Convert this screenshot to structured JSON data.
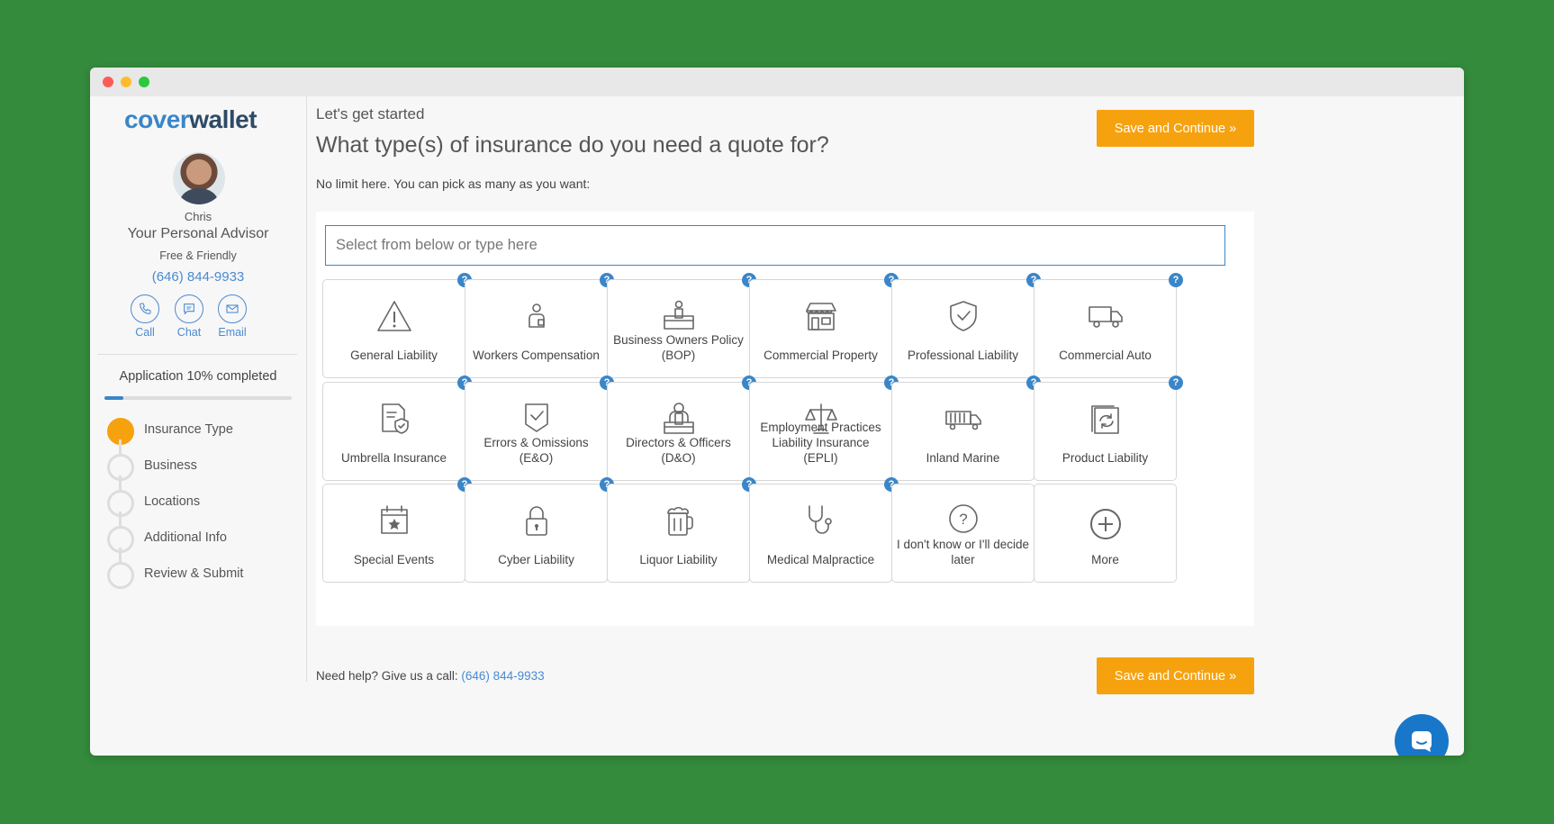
{
  "brand": {
    "logo_part1": "cover",
    "logo_part2": "wallet"
  },
  "advisor": {
    "name": "Chris",
    "role": "Your Personal Advisor",
    "tagline": "Free & Friendly",
    "phone": "(646) 844-9933",
    "actions": [
      {
        "label": "Call",
        "icon": "phone-icon"
      },
      {
        "label": "Chat",
        "icon": "chat-icon"
      },
      {
        "label": "Email",
        "icon": "email-icon"
      }
    ]
  },
  "progress": {
    "text": "Application 10% completed",
    "percent": 10
  },
  "steps": [
    {
      "label": "Insurance Type",
      "active": true
    },
    {
      "label": "Business",
      "active": false
    },
    {
      "label": "Locations",
      "active": false
    },
    {
      "label": "Additional Info",
      "active": false
    },
    {
      "label": "Review & Submit",
      "active": false
    }
  ],
  "main": {
    "eyebrow": "Let's get started",
    "heading": "What type(s) of insurance do you need a quote for?",
    "subheading": "No limit here. You can pick as many as you want:",
    "save_label": "Save and Continue »",
    "search_placeholder": "Select from below or type here",
    "help_symbol": "?",
    "footer_text": "Need help? Give us a call: ",
    "footer_phone": "(646) 844-9933"
  },
  "insurance_types": [
    {
      "label": "General Liability",
      "icon": "warning-icon",
      "help": true
    },
    {
      "label": "Workers Compensation",
      "icon": "worker-icon",
      "help": true
    },
    {
      "label": "Business Owners Policy (BOP)",
      "icon": "business-owner-icon",
      "help": true
    },
    {
      "label": "Commercial Property",
      "icon": "storefront-icon",
      "help": true
    },
    {
      "label": "Professional Liability",
      "icon": "shield-check-icon",
      "help": true
    },
    {
      "label": "Commercial Auto",
      "icon": "truck-icon",
      "help": true
    },
    {
      "label": "Umbrella Insurance",
      "icon": "document-shield-icon",
      "help": true
    },
    {
      "label": "Errors & Omissions (E&O)",
      "icon": "badge-check-icon",
      "help": true
    },
    {
      "label": "Directors & Officers (D&O)",
      "icon": "director-icon",
      "help": true
    },
    {
      "label": "Employment Practices Liability Insurance (EPLI)",
      "icon": "scales-icon",
      "help": true
    },
    {
      "label": "Inland Marine",
      "icon": "cargo-truck-icon",
      "help": true
    },
    {
      "label": "Product Liability",
      "icon": "product-box-icon",
      "help": true
    },
    {
      "label": "Special Events",
      "icon": "calendar-star-icon",
      "help": true
    },
    {
      "label": "Cyber Liability",
      "icon": "lock-icon",
      "help": true
    },
    {
      "label": "Liquor Liability",
      "icon": "beer-mug-icon",
      "help": true
    },
    {
      "label": "Medical Malpractice",
      "icon": "stethoscope-icon",
      "help": true
    },
    {
      "label": "I don't know or I'll decide later",
      "icon": "question-circle-icon",
      "help": false
    },
    {
      "label": "More",
      "icon": "plus-circle-icon",
      "help": false
    }
  ],
  "colors": {
    "accent": "#f6a20f",
    "link": "#4a8ad0",
    "brand_blue": "#3a86c8",
    "background": "#348b3c"
  }
}
